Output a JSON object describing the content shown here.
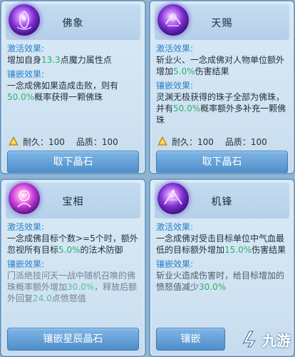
{
  "cards": [
    {
      "title": "佛象",
      "activate_label": "激活效果:",
      "activate_text": [
        "增加自身",
        "13.3",
        "点魔力属性点"
      ],
      "inlay_label": "镶嵌效果:",
      "inlay_text": [
        "一念成佛如果造成击败，则有",
        "50.0%",
        "概率获得一颗佛珠"
      ],
      "durability_label": "耐久：100",
      "quality_label": "品质：100",
      "button": "取下晶石"
    },
    {
      "title": "天赐",
      "activate_label": "激活效果:",
      "activate_text": [
        "斩业火、一念成佛对人物单位额外增加",
        "5.0%",
        "伤害结果"
      ],
      "inlay_label": "镶嵌效果:",
      "inlay_text": [
        "灵渊无极获得的珠子全部为佛珠，并有",
        "50.0%",
        "概率额外多补充一颗佛珠"
      ],
      "durability_label": "耐久：100",
      "quality_label": "品质：100",
      "button": "取下晶石"
    },
    {
      "title": "宝相",
      "activate_label": "激活效果:",
      "activate_text": [
        "一念成佛目标个数>=5个时，额外忽视所有目标",
        "5.0%",
        "的法术防御"
      ],
      "inlay_label": "镶嵌效果:",
      "inlay_text": [
        "门派绝技问天一战中随机召唤的佛珠概率额外增加",
        "30.0%",
        "，释放后额外回复",
        "24.0",
        "点愤怒值"
      ],
      "button": "镶嵌星辰晶石"
    },
    {
      "title": "机锋",
      "activate_label": "激活效果:",
      "activate_text": [
        "一念成佛对受击目标单位中气血最低的目标额外增加",
        "15.0%",
        "伤害结果"
      ],
      "inlay_label": "镶嵌效果:",
      "inlay_text": [
        "斩业火造成伤害时，给目标增加的愤怒值减少",
        "30.0%",
        ""
      ],
      "button": "镶嵌"
    }
  ],
  "watermark": "九游",
  "colors": {
    "label": "#2a80c9",
    "highlight": "#2bb36a",
    "button": "#5b9ad3"
  },
  "icons": [
    "buddha-gem-icon",
    "heavenly-gift-gem-icon",
    "treasure-form-gem-icon",
    "keen-edge-gem-icon",
    "coin-icon"
  ]
}
